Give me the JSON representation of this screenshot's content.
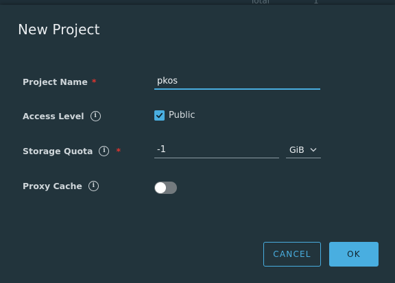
{
  "background": {
    "peek_label": "Total",
    "peek_value": "1"
  },
  "dialog": {
    "title": "New Project",
    "project_name": {
      "label": "Project Name",
      "required": "*",
      "value": "pkos"
    },
    "access_level": {
      "label": "Access Level",
      "info_glyph": "i",
      "checkbox_label": "Public",
      "checked": true
    },
    "storage_quota": {
      "label": "Storage Quota",
      "info_glyph": "i",
      "required": "*",
      "value": "-1",
      "unit": "GiB"
    },
    "proxy_cache": {
      "label": "Proxy Cache",
      "info_glyph": "i",
      "enabled": false
    },
    "buttons": {
      "cancel": "CANCEL",
      "ok": "OK"
    }
  },
  "colors": {
    "accent": "#49aee0",
    "required": "#e0352f",
    "modal_bg": "#22343c",
    "toggle_off": "#737a7e"
  },
  "icons": {
    "info": "info-circle-icon",
    "check": "checkmark-icon",
    "chevron": "chevron-down-icon"
  }
}
